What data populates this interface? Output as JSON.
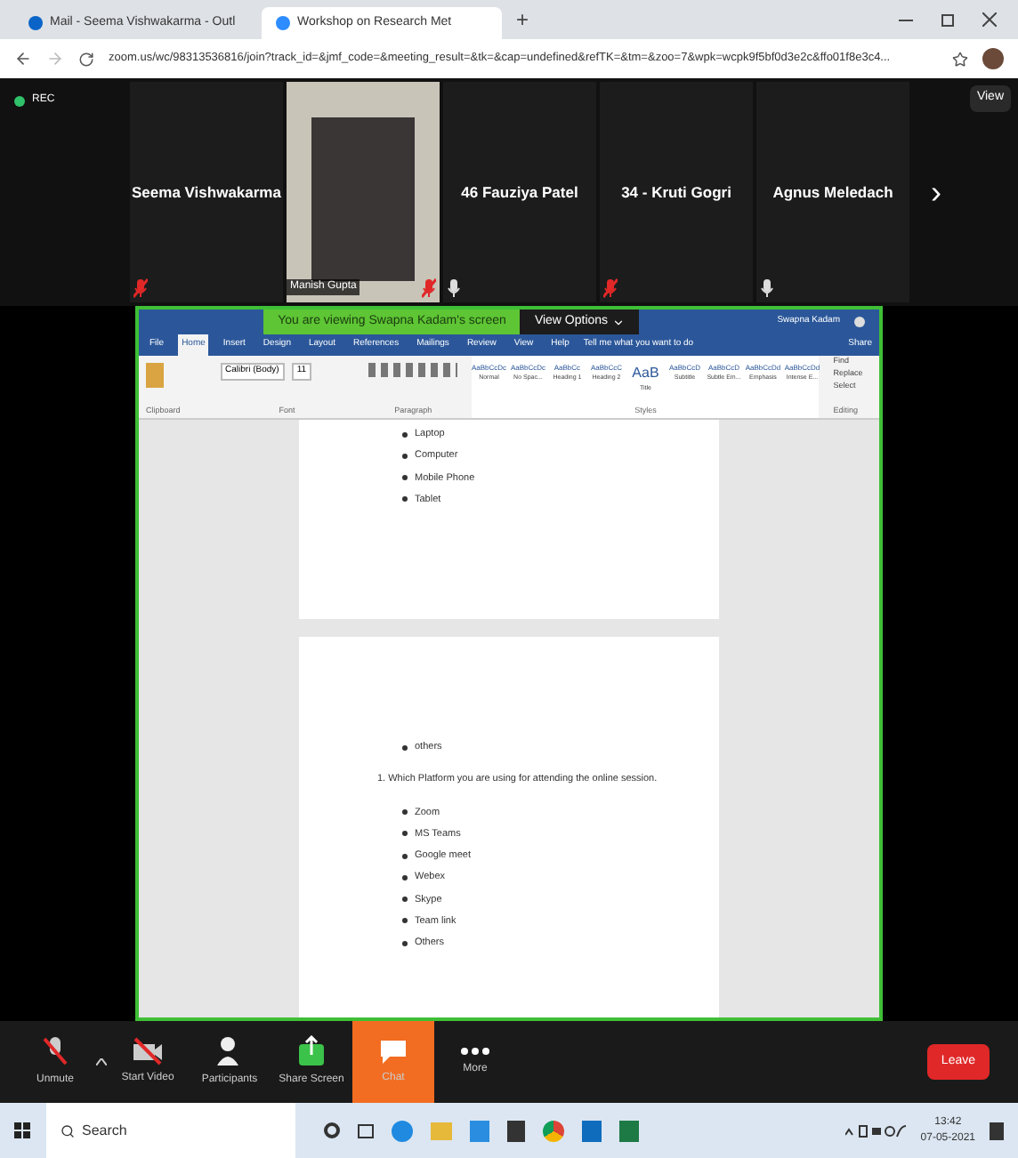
{
  "browser": {
    "tabs": [
      {
        "label": "Mail - Seema Vishwakarma - Outl",
        "selected": false
      },
      {
        "label": "Workshop on Research Met",
        "selected": true
      }
    ],
    "url": "zoom.us/wc/98313536816/join?track_id=&jmf_code=&meeting_result=&tk=&cap=undefined&refTK=&tm=&zoo=7&wpk=wcpk9f5bf0d3e2c&ffo01f8e3c4...",
    "new_tab": "+"
  },
  "meeting": {
    "recording": "REC",
    "view_button": "View",
    "participants": [
      {
        "name": "Seema Vishwakarma",
        "kind": "name",
        "muted": true
      },
      {
        "name": "Manish Gupta",
        "kind": "video",
        "muted": true
      },
      {
        "name": "46 Fauziya Patel",
        "kind": "name",
        "muted": false
      },
      {
        "name": "34 - Kruti Gogri",
        "kind": "name",
        "muted": true
      },
      {
        "name": "Agnus Meledach",
        "kind": "name",
        "muted": false
      }
    ],
    "next": "›",
    "share_banner": "You are viewing Swapna Kadam's screen",
    "view_options": "View Options"
  },
  "word": {
    "user": "Swapna Kadam",
    "ribbon_tabs": [
      {
        "label": "File",
        "selected": false
      },
      {
        "label": "Home",
        "selected": true
      },
      {
        "label": "Insert",
        "selected": false
      },
      {
        "label": "Design",
        "selected": false
      },
      {
        "label": "Layout",
        "selected": false
      },
      {
        "label": "References",
        "selected": false
      },
      {
        "label": "Mailings",
        "selected": false
      },
      {
        "label": "Review",
        "selected": false
      },
      {
        "label": "View",
        "selected": false
      },
      {
        "label": "Help",
        "selected": false
      }
    ],
    "tell_me": "Tell me what you want to do",
    "share": "Share",
    "font": "Calibri (Body)",
    "size": "11",
    "styles": [
      "AaBbCcDc",
      "AaBbCcDc",
      "AaBbCc",
      "AaBbCcC",
      "AaB",
      "AaBbCcD",
      "AaBbCcD",
      "AaBbCcDd",
      "AaBbCcDd"
    ],
    "style_names": [
      "Normal",
      "No Spac...",
      "Heading 1",
      "Heading 2",
      "Title",
      "Subtitle",
      "Subtle Em...",
      "Emphasis",
      "Intense E..."
    ],
    "editing": [
      "Find",
      "Replace",
      "Select"
    ],
    "groups": [
      "Clipboard",
      "Font",
      "Paragraph",
      "Styles",
      "Editing"
    ],
    "page1": [
      "Laptop",
      "Computer",
      "Mobile Phone",
      "Tablet"
    ],
    "page2_bullets": [
      "others"
    ],
    "question": "1.  Which Platform you are using for attending the online session.",
    "answers": [
      "Zoom",
      "MS Teams",
      "Google meet",
      "Webex",
      "Skype",
      "Team link",
      "Others"
    ]
  },
  "toolbar": [
    {
      "label": "Unmute",
      "kind": "mic"
    },
    {
      "label": "Start Video",
      "kind": "video"
    },
    {
      "label": "Participants",
      "kind": "people"
    },
    {
      "label": "Share Screen",
      "kind": "share"
    },
    {
      "label": "Chat",
      "kind": "chat"
    },
    {
      "label": "More",
      "kind": "more"
    }
  ],
  "leave": "Leave",
  "taskbar": {
    "search": "Search",
    "time": "13:42",
    "date": "07-05-2021"
  }
}
